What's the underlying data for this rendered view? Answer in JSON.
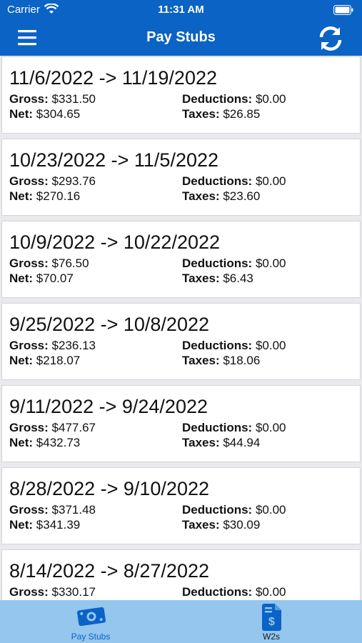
{
  "status_bar": {
    "carrier": "Carrier",
    "time": "11:31 AM"
  },
  "nav": {
    "title": "Pay Stubs",
    "menu_icon": "hamburger-menu-icon",
    "refresh_icon": "refresh-icon"
  },
  "labels": {
    "gross": "Gross:",
    "net": "Net:",
    "deductions": "Deductions:",
    "taxes": "Taxes:"
  },
  "paystubs": [
    {
      "range": "11/6/2022 -> 11/19/2022",
      "gross": "$331.50",
      "net": "$304.65",
      "deductions": "$0.00",
      "taxes": "$26.85"
    },
    {
      "range": "10/23/2022 -> 11/5/2022",
      "gross": "$293.76",
      "net": "$270.16",
      "deductions": "$0.00",
      "taxes": "$23.60"
    },
    {
      "range": "10/9/2022 -> 10/22/2022",
      "gross": "$76.50",
      "net": "$70.07",
      "deductions": "$0.00",
      "taxes": "$6.43"
    },
    {
      "range": "9/25/2022 -> 10/8/2022",
      "gross": "$236.13",
      "net": "$218.07",
      "deductions": "$0.00",
      "taxes": "$18.06"
    },
    {
      "range": "9/11/2022 -> 9/24/2022",
      "gross": "$477.67",
      "net": "$432.73",
      "deductions": "$0.00",
      "taxes": "$44.94"
    },
    {
      "range": "8/28/2022 -> 9/10/2022",
      "gross": "$371.48",
      "net": "$341.39",
      "deductions": "$0.00",
      "taxes": "$30.09"
    },
    {
      "range": "8/14/2022 -> 8/27/2022",
      "gross": "$330.17",
      "deductions": "$0.00"
    }
  ],
  "tabs": [
    {
      "label": "Pay Stubs",
      "icon": "money-icon",
      "selected": true
    },
    {
      "label": "W2s",
      "icon": "document-dollar-icon",
      "selected": false
    }
  ],
  "colors": {
    "accent": "#0a63c5",
    "tabbar": "#94c6ee",
    "tab_selected": "#0a63c5",
    "tab_unselected": "#1a1a1a"
  }
}
